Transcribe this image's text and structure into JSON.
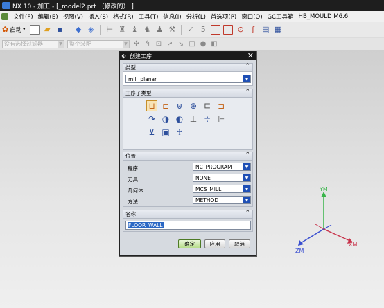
{
  "window": {
    "title": "NX 10 - 加工 - [_model2.prt （修改的） ]"
  },
  "menubar": {
    "items": [
      "文件(F)",
      "编辑(E)",
      "视图(V)",
      "插入(S)",
      "格式(R)",
      "工具(T)",
      "信息(I)",
      "分析(L)",
      "首选项(P)",
      "窗口(O)",
      "GC工具箱",
      "HB_MOULD M6.6"
    ]
  },
  "toolbar": {
    "start_label": "启动"
  },
  "filterbar": {
    "filter_placeholder": "没有选择过滤器",
    "type_placeholder": "整个装配"
  },
  "dialog": {
    "title": "创建工序",
    "type_section": "类型",
    "type_value": "mill_planar",
    "subtype_section": "工序子类型",
    "location_section": "位置",
    "location": {
      "program_label": "程序",
      "program_value": "NC_PROGRAM",
      "tool_label": "刀具",
      "tool_value": "NONE",
      "geometry_label": "几何体",
      "geometry_value": "MCS_MILL",
      "method_label": "方法",
      "method_value": "METHOD"
    },
    "name_section": "名称",
    "name_value": "FLOOR_WALL",
    "ok_label": "确定",
    "apply_label": "应用",
    "cancel_label": "取消"
  },
  "axes": {
    "x_label": "XM",
    "y_label": "YM",
    "z_label": "ZM",
    "x_color": "#c8324a",
    "y_color": "#39b54a",
    "z_color": "#3a4fd0"
  }
}
